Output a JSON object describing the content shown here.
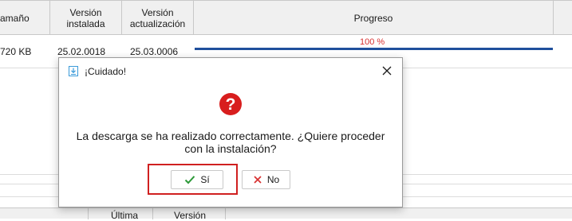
{
  "table": {
    "headers": {
      "size": "amaño",
      "installed": "Versión\ninstalada",
      "update": "Versión\nactualización",
      "progress": "Progreso"
    },
    "row": {
      "size": "720 KB",
      "installed": "25.02.0018",
      "update": "25.03.0006",
      "progress_label": "100 %",
      "progress_value": 100
    },
    "bottom_headers": {
      "last": "Última",
      "version": "Versión"
    }
  },
  "dialog": {
    "title": "¡Cuidado!",
    "message": "La descarga se ha realizado correctamente. ¿Quiere proceder con la instalación?",
    "icon": "question-icon",
    "buttons": {
      "yes_label": "Sí",
      "no_label": "No"
    }
  },
  "colors": {
    "progress_fill": "#1f4f9c",
    "progress_text": "#d83030",
    "highlight": "#d02020",
    "question_icon": "#d81e1e",
    "yes_check": "#2e9a3a",
    "no_x": "#d83030"
  }
}
